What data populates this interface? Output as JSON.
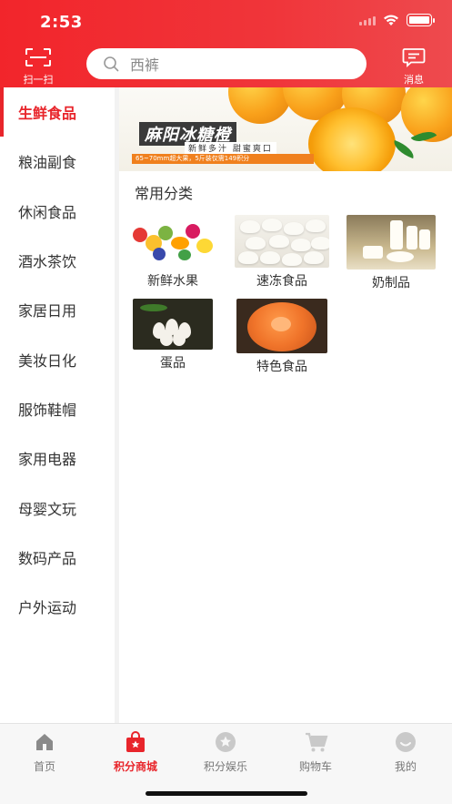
{
  "status_bar": {
    "time": "2:53"
  },
  "header": {
    "scan_label": "扫一扫",
    "search_placeholder": "西裤",
    "message_label": "消息"
  },
  "sidebar": {
    "items": [
      {
        "label": "生鲜食品",
        "active": true
      },
      {
        "label": "粮油副食",
        "active": false
      },
      {
        "label": "休闲食品",
        "active": false
      },
      {
        "label": "酒水茶饮",
        "active": false
      },
      {
        "label": "家居日用",
        "active": false
      },
      {
        "label": "美妆日化",
        "active": false
      },
      {
        "label": "服饰鞋帽",
        "active": false
      },
      {
        "label": "家用电器",
        "active": false
      },
      {
        "label": "母婴文玩",
        "active": false
      },
      {
        "label": "数码产品",
        "active": false
      },
      {
        "label": "户外运动",
        "active": false
      }
    ]
  },
  "banner": {
    "title": "麻阳冰糖橙",
    "subtitle": "新鲜多汁 甜蜜爽口",
    "strip": "65~70mm超大果，5斤装仅需149积分"
  },
  "section": {
    "title": "常用分类"
  },
  "categories": [
    {
      "label": "新鲜水果",
      "icon": "fruit-image"
    },
    {
      "label": "速冻食品",
      "icon": "dumplings-image"
    },
    {
      "label": "奶制品",
      "icon": "dairy-image"
    },
    {
      "label": "蛋品",
      "icon": "eggs-image"
    },
    {
      "label": "特色食品",
      "icon": "special-food-image"
    }
  ],
  "tabbar": {
    "tabs": [
      {
        "label": "首页",
        "icon": "home-icon",
        "active": false
      },
      {
        "label": "积分商城",
        "icon": "shop-bag-icon",
        "active": true
      },
      {
        "label": "积分娱乐",
        "icon": "star-icon",
        "active": false
      },
      {
        "label": "购物车",
        "icon": "cart-icon",
        "active": false
      },
      {
        "label": "我的",
        "icon": "face-icon",
        "active": false
      }
    ]
  },
  "colors": {
    "brand_red": "#e8252b",
    "inactive_gray": "#777777"
  }
}
